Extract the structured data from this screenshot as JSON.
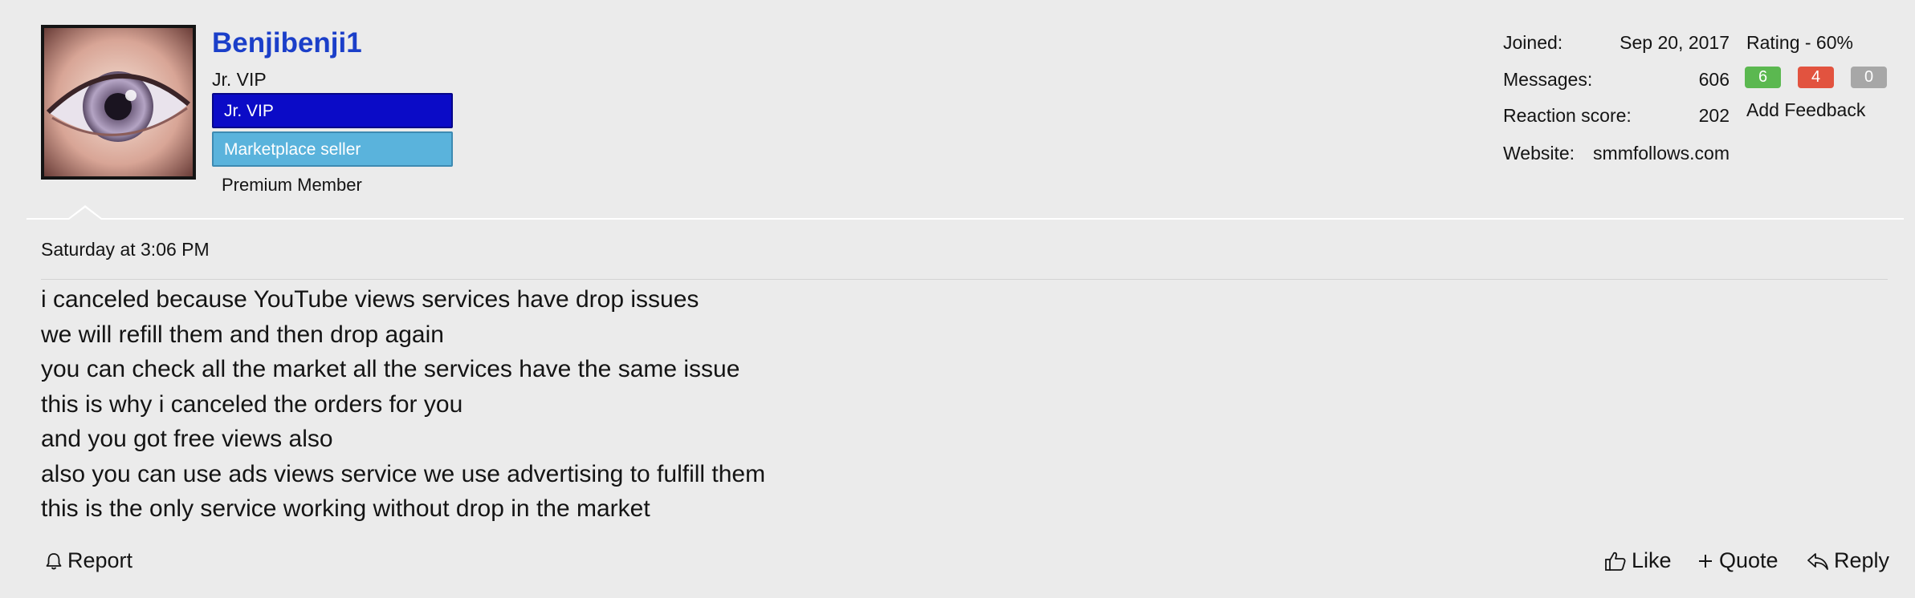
{
  "user": {
    "name": "Benjibenji1",
    "title": "Jr. VIP",
    "banners": [
      "Jr. VIP",
      "Marketplace seller"
    ],
    "premium_label": "Premium Member"
  },
  "stats": {
    "joined_label": "Joined:",
    "joined_value": "Sep 20, 2017",
    "messages_label": "Messages:",
    "messages_value": "606",
    "reaction_label": "Reaction score:",
    "reaction_value": "202",
    "website_label": "Website:",
    "website_value": "smmfollows.com"
  },
  "feedback": {
    "rating_label": "Rating - 60%",
    "positive": "6",
    "negative": "4",
    "neutral": "0",
    "add_label": "Add Feedback",
    "colors": {
      "positive": "#5bb850",
      "negative": "#e2533f",
      "neutral": "#a7a7a7"
    }
  },
  "post": {
    "timestamp": "Saturday at 3:06 PM",
    "lines": [
      "i canceled because YouTube views services have drop issues",
      "we will refill them and then drop again",
      "you can check all the market all the services have the same issue",
      "this is why i canceled the orders for you",
      "and you got free views also",
      "also you can use ads views service we use advertising to fulfill them",
      "this is the only service working without drop in the market"
    ]
  },
  "actions": {
    "report": {
      "label": "Report",
      "icon": "bell-icon"
    },
    "like": {
      "label": "Like",
      "icon": "thumbs-up-icon"
    },
    "quote": {
      "label": "Quote",
      "icon": "plus-icon"
    },
    "reply": {
      "label": "Reply",
      "icon": "reply-icon"
    }
  },
  "colors": {
    "username": "#1b3fc9",
    "banner_vip": "#0b0bc7",
    "banner_market": "#5ab3dc",
    "background": "#ebebeb"
  }
}
